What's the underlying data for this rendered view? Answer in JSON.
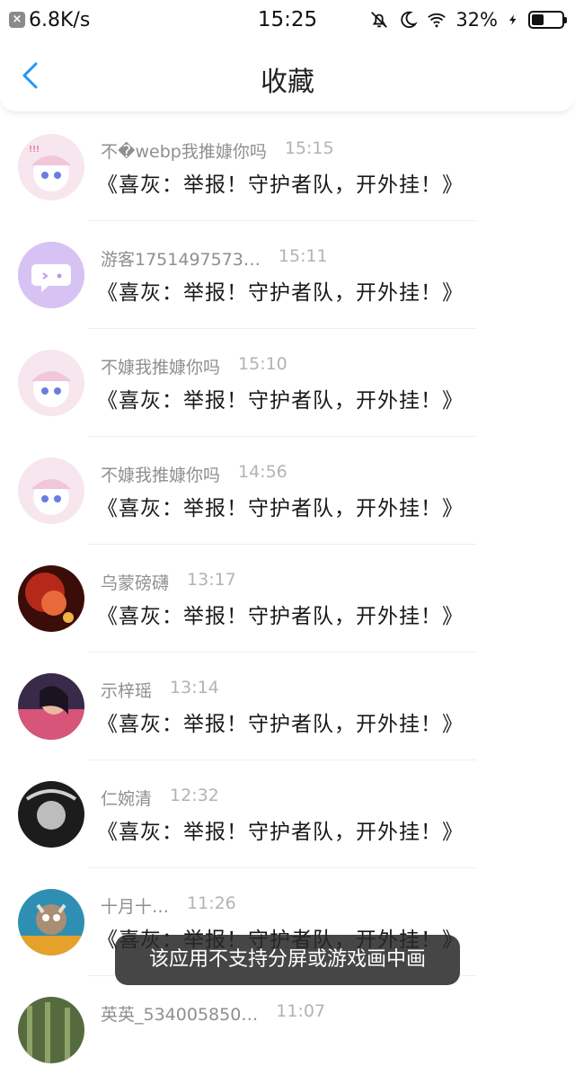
{
  "status_bar": {
    "speed": "6.8K/s",
    "time": "15:25",
    "battery": "32%"
  },
  "nav": {
    "title": "收藏"
  },
  "items": [
    {
      "name": "不�webp我推嫝你吗",
      "time": "15:15",
      "text": "《喜灰：举报！守护者队，开外挂！》"
    },
    {
      "name": "游客1751497573…",
      "time": "15:11",
      "text": "《喜灰：举报！守护者队，开外挂！》"
    },
    {
      "name": "不嫝我推嫝你吗",
      "time": "15:10",
      "text": "《喜灰：举报！守护者队，开外挂！》"
    },
    {
      "name": "不嫝我推嫝你吗",
      "time": "14:56",
      "text": "《喜灰：举报！守护者队，开外挂！》"
    },
    {
      "name": "乌蒙磅礴",
      "time": "13:17",
      "text": "《喜灰：举报！守护者队，开外挂！》"
    },
    {
      "name": "示梓瑶",
      "time": "13:14",
      "text": "《喜灰：举报！守护者队，开外挂！》"
    },
    {
      "name": "仁婉清",
      "time": "12:32",
      "text": "《喜灰：举报！守护者队，开外挂！》"
    },
    {
      "name": "十月十…",
      "time": "11:26",
      "text": "《喜灰：举报！守护者队，开外挂！》"
    },
    {
      "name": "英英_534005850…",
      "time": "11:07",
      "text": ""
    }
  ],
  "toast": {
    "text": "该应用不支持分屏或游戏画中画"
  }
}
